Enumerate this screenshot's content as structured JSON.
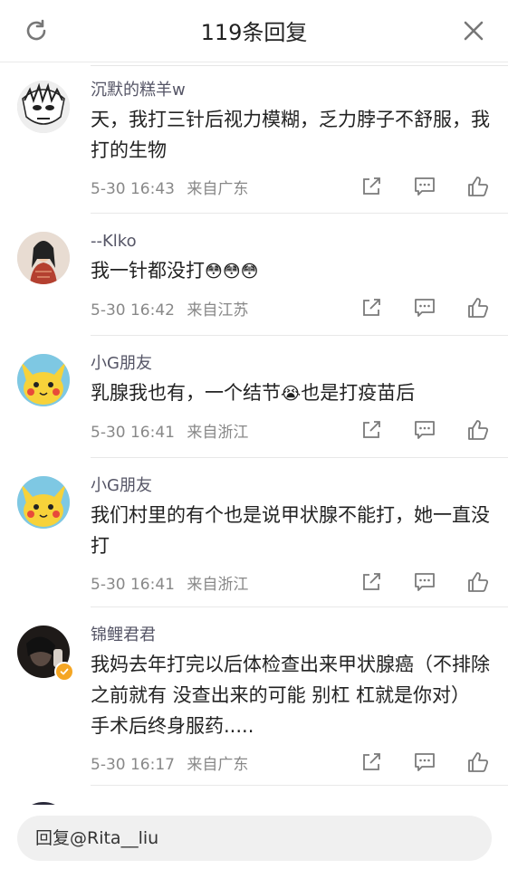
{
  "header": {
    "title": "119条回复",
    "refresh_icon": "refresh-icon",
    "close_icon": "close-icon"
  },
  "comments": [
    {
      "user": "沉默的糕羊w",
      "text": "天，我打三针后视力模糊，乏力脖子不舒服，我打的生物",
      "time": "5-30 16:43",
      "location": "来自广东",
      "avatar": "manga-face"
    },
    {
      "user": "--Klko",
      "text": "我一针都没打",
      "emojis": [
        "😳",
        "😳",
        "😳"
      ],
      "time": "5-30 16:42",
      "location": "来自江苏",
      "avatar": "girl-photo"
    },
    {
      "user": "小G朋友",
      "text_before": "乳腺我也有，一个结节",
      "emoji": "😭",
      "text_after": "也是打疫苗后",
      "time": "5-30 16:41",
      "location": "来自浙江",
      "avatar": "pikachu"
    },
    {
      "user": "小G朋友",
      "text": "我们村里的有个也是说甲状腺不能打，她一直没打",
      "time": "5-30 16:41",
      "location": "来自浙江",
      "avatar": "pikachu"
    },
    {
      "user": "锦鲤君君",
      "text": "我妈去年打完以后体检查出来甲状腺癌（不排除之前就有 没查出来的可能 别杠 杠就是你对） 手术后终身服药.....",
      "time": "5-30 16:17",
      "location": "来自广东",
      "avatar": "dark-photo",
      "verified": true
    }
  ],
  "reply": {
    "placeholder": "回复@Rita__liu"
  },
  "colors": {
    "background": "#ffffff",
    "divider": "#e8e8e8",
    "meta_text": "#888888",
    "icon": "#7a7a7a",
    "input_bg": "#f0f0f0",
    "verified_badge": "#f5a623"
  },
  "icons": {
    "share": "share-icon",
    "comment": "comment-icon",
    "like": "like-icon"
  }
}
